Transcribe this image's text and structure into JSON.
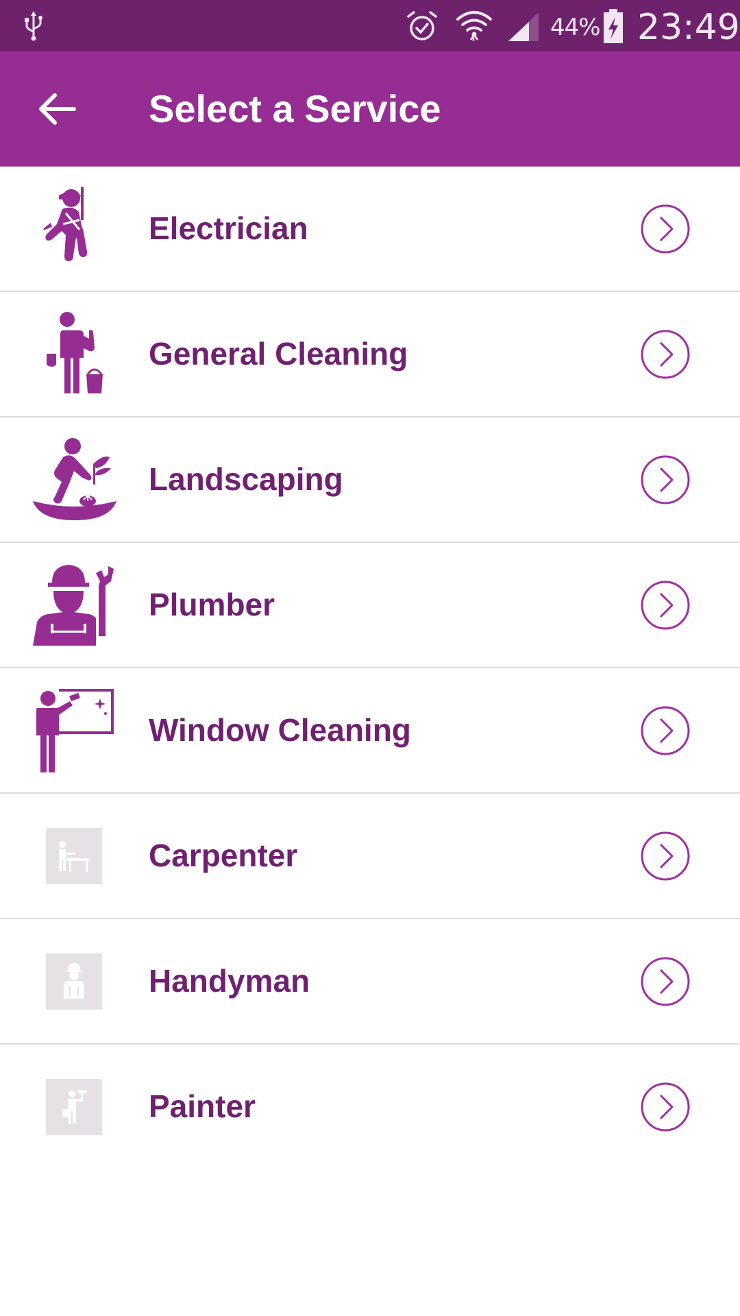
{
  "status_bar": {
    "battery_percent": "44%",
    "time": "23:49",
    "icons": [
      "usb-icon",
      "alarm-icon",
      "wifi-icon",
      "signal-icon",
      "battery-charging-icon"
    ]
  },
  "app_bar": {
    "title": "Select a Service",
    "back_icon": "arrow-back-icon"
  },
  "services": [
    {
      "label": "Electrician",
      "icon": "electrician-icon"
    },
    {
      "label": "General Cleaning",
      "icon": "cleaner-icon"
    },
    {
      "label": "Landscaping",
      "icon": "gardener-icon"
    },
    {
      "label": "Plumber",
      "icon": "plumber-icon"
    },
    {
      "label": "Window Cleaning",
      "icon": "window-cleaner-icon"
    },
    {
      "label": "Carpenter",
      "icon": "carpenter-placeholder-icon"
    },
    {
      "label": "Handyman",
      "icon": "handyman-placeholder-icon"
    },
    {
      "label": "Painter",
      "icon": "painter-placeholder-icon"
    }
  ],
  "colors": {
    "status_bar": "#6e226c",
    "app_bar": "#962d93",
    "label": "#6f2170",
    "icon": "#962d93",
    "chevron": "#a02fa0",
    "divider": "#dcdcdc"
  }
}
